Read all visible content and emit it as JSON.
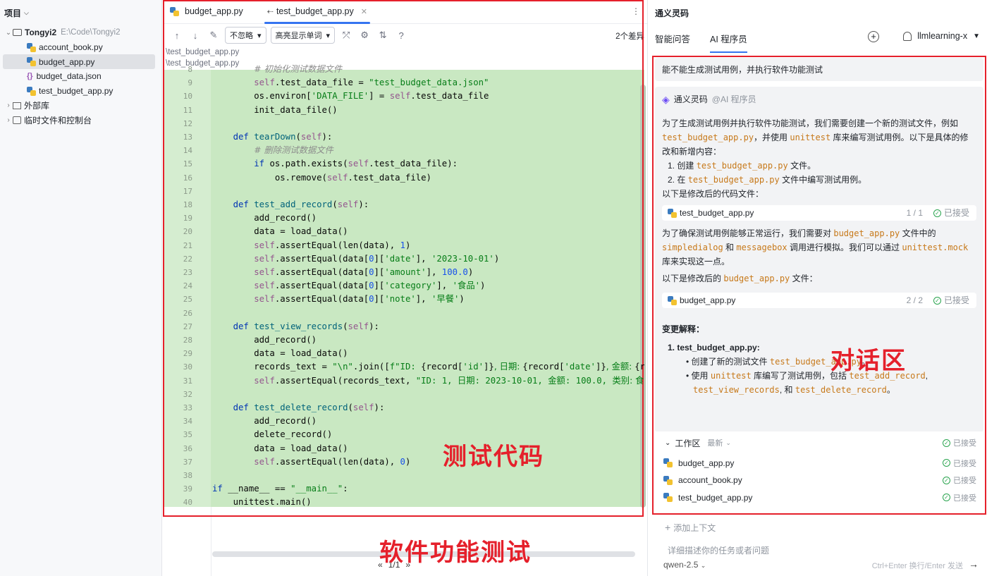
{
  "project": {
    "title": "项目",
    "root": "Tongyi2",
    "root_path": "E:\\Code\\Tongyi2",
    "files": [
      "account_book.py",
      "budget_app.py",
      "budget_data.json",
      "test_budget_app.py"
    ],
    "external": "外部库",
    "scratch": "临时文件和控制台"
  },
  "editor": {
    "tabs": [
      "budget_app.py",
      "test_budget_app.py"
    ],
    "ignore_label": "不忽略",
    "highlight_label": "高亮显示单词",
    "diff_count": "2个差异",
    "path1": "\\test_budget_app.py",
    "path2": "\\test_budget_app.py",
    "pager": "1/1"
  },
  "annotations": {
    "code": "测试代码",
    "test": "软件功能测试",
    "chat": "对话区"
  },
  "ai": {
    "title": "通义灵码",
    "tabs": [
      "智能问答",
      "AI 程序员"
    ],
    "user": "llmlearning-x",
    "question": "能不能生成测试用例，并执行软件功能测试",
    "agent": "通义灵码",
    "agent_tag": "@AI 程序员",
    "p1": "为了生成测试用例并执行软件功能测试，我们需要创建一个新的测试文件，例如",
    "p1_code": "test_budget_app.py",
    "p1_mid": "，并使用",
    "p1_code2": "unittest",
    "p1_end": "库来编写测试用例。以下是具体的修改和新增内容：",
    "li1_a": "1. 创建",
    "li1_code": "test_budget_app.py",
    "li1_b": "文件。",
    "li2_a": "2. 在",
    "li2_code": "test_budget_app.py",
    "li2_b": "文件中编写测试用例。",
    "p2": "以下是修改后的代码文件：",
    "card1": {
      "name": "test_budget_app.py",
      "count": "1 / 1",
      "status": "已接受"
    },
    "p3_a": "为了确保测试用例能够正常运行，我们需要对",
    "p3_code": "budget_app.py",
    "p3_b": "文件中的",
    "p3_code2": "simpledialog",
    "p3_c": "和",
    "p3_code3": "messagebox",
    "p3_d": "调用进行模拟。我们可以通过",
    "p3_code4": "unittest.mock",
    "p3_e": "库来实现这一点。",
    "p4_a": "以下是修改后的",
    "p4_code": "budget_app.py",
    "p4_b": "文件：",
    "card2": {
      "name": "budget_app.py",
      "count": "2 / 2",
      "status": "已接受"
    },
    "changes": "变更解释：",
    "c1": "1. test_budget_app.py:",
    "c1a_a": "创建了新的测试文件",
    "c1a_code": "test_budget_app.py",
    "c1a_b": "。",
    "c1b_a": "使用",
    "c1b_code": "unittest",
    "c1b_b": "库编写了测试用例，包括",
    "c1b_c1": "test_add_record",
    "c1b_c2": "test_view_records",
    "c1b_mid": ", 和",
    "c1b_c3": "test_delete_record",
    "c1b_end": "。",
    "work_label": "工作区",
    "work_sort": "最新",
    "work_status": "已接受",
    "work_files": [
      "budget_app.py",
      "account_book.py",
      "test_budget_app.py"
    ],
    "add_ctx": "添加上下文",
    "input_placeholder": "详细描述你的任务或者问题",
    "model": "qwen-2.5",
    "hint": "Ctrl+Enter 换行/Enter 发送"
  }
}
